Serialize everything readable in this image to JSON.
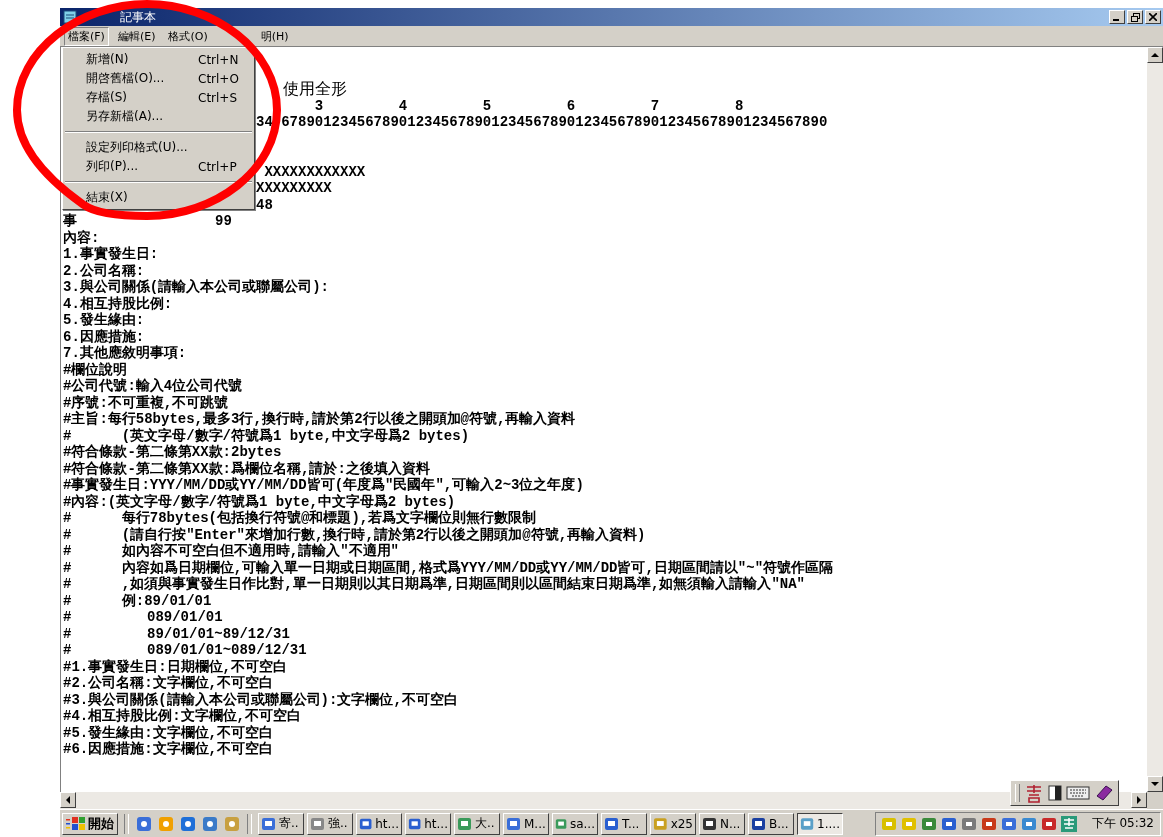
{
  "window": {
    "title": "記事本"
  },
  "menu_bar": [
    {
      "kind": "plain",
      "label": "檔案(F)",
      "selected": true
    },
    {
      "kind": "plain",
      "label": "編輯(E)",
      "selected": false
    },
    {
      "kind": "plain",
      "label": "格式(O)",
      "selected": false
    },
    {
      "kind": "cut",
      "label": "明(H)",
      "selected": false
    }
  ],
  "file_menu": [
    {
      "kind": "item",
      "label": "新增(N)",
      "shortcut": "Ctrl+N"
    },
    {
      "kind": "item",
      "label": "開啓舊檔(O)...",
      "shortcut": "Ctrl+O"
    },
    {
      "kind": "item",
      "label": "存檔(S)",
      "shortcut": "Ctrl+S"
    },
    {
      "kind": "item",
      "label": "另存新檔(A)..."
    },
    {
      "kind": "separator"
    },
    {
      "kind": "item",
      "label": "設定列印格式(U)..."
    },
    {
      "kind": "item",
      "label": "列印(P)...",
      "shortcut": "Ctrl+P"
    },
    {
      "kind": "separator"
    },
    {
      "kind": "item",
      "label": "結束(X)"
    }
  ],
  "editor_lines": [
    {
      "kind": "hidden"
    },
    {
      "kind": "hidden"
    },
    {
      "kind": "beside-menu-large",
      "text": "使用全形"
    },
    {
      "kind": "beside-menu",
      "text": "       3         4         5         6         7         8"
    },
    {
      "kind": "beside-menu-split",
      "parts": [
        "34",
        "67890123456789012345678901234567890123456789012345678901234567890"
      ]
    },
    {
      "kind": "hidden"
    },
    {
      "kind": "hidden"
    },
    {
      "kind": "beside-menu-indent",
      "text": "XXXXXXXXXXXX"
    },
    {
      "kind": "beside-menu",
      "text": "XXXXXXXXX"
    },
    {
      "kind": "beside-menu",
      "text": "48"
    },
    {
      "kind": "split",
      "parts": [
        "事",
        "99"
      ]
    },
    {
      "kind": "plain",
      "text": "內容:"
    },
    {
      "kind": "plain",
      "text": "1.事實發生日:"
    },
    {
      "kind": "plain",
      "text": "2.公司名稱:"
    },
    {
      "kind": "plain",
      "text": "3.與公司關係(請輸入本公司或聯屬公司):"
    },
    {
      "kind": "plain",
      "text": "4.相互持股比例:"
    },
    {
      "kind": "plain",
      "text": "5.發生緣由:"
    },
    {
      "kind": "plain",
      "text": "6.因應措施:"
    },
    {
      "kind": "plain",
      "text": "7.其他應敘明事項:"
    },
    {
      "kind": "plain",
      "text": "#欄位說明"
    },
    {
      "kind": "plain",
      "text": "#公司代號:輸入4位公司代號"
    },
    {
      "kind": "plain",
      "text": "#序號:不可重複,不可跳號"
    },
    {
      "kind": "plain",
      "text": "#主旨:每行58bytes,最多3行,換行時,請於第2行以後之開頭加@符號,再輸入資料"
    },
    {
      "kind": "plain",
      "text": "#      (英文字母/數字/符號爲1 byte,中文字母爲2 bytes)"
    },
    {
      "kind": "plain",
      "text": "#符合條款-第二條第XX款:2bytes"
    },
    {
      "kind": "plain",
      "text": "#符合條款-第二條第XX款:爲欄位名稱,請於:之後填入資料"
    },
    {
      "kind": "plain",
      "text": "#事實發生日:YYY/MM/DD或YY/MM/DD皆可(年度爲\"民國年\",可輸入2~3位之年度)"
    },
    {
      "kind": "plain",
      "text": "#內容:(英文字母/數字/符號爲1 byte,中文字母爲2 bytes)"
    },
    {
      "kind": "plain",
      "text": "#      每行78bytes(包括換行符號@和標題),若爲文字欄位則無行數限制"
    },
    {
      "kind": "plain",
      "text": "#      (請自行按\"Enter\"來增加行數,換行時,請於第2行以後之開頭加@符號,再輸入資料)"
    },
    {
      "kind": "plain",
      "text": "#      如內容不可空白但不適用時,請輸入\"不適用\""
    },
    {
      "kind": "plain",
      "text": "#      內容如爲日期欄位,可輸入單一日期或日期區間,格式爲YYY/MM/DD或YY/MM/DD皆可,日期區間請以\"~\"符號作區隔"
    },
    {
      "kind": "plain",
      "text": "#      ,如須與事實發生日作比對,單一日期則以其日期爲準,日期區間則以區間結束日期爲準,如無須輸入請輸入\"NA\""
    },
    {
      "kind": "plain",
      "text": "#      例:89/01/01"
    },
    {
      "kind": "plain",
      "text": "#         089/01/01"
    },
    {
      "kind": "plain",
      "text": "#         89/01/01~89/12/31"
    },
    {
      "kind": "plain",
      "text": "#         089/01/01~089/12/31"
    },
    {
      "kind": "plain",
      "text": "#1.事實發生日:日期欄位,不可空白"
    },
    {
      "kind": "plain",
      "text": "#2.公司名稱:文字欄位,不可空白"
    },
    {
      "kind": "plain",
      "text": "#3.與公司關係(請輸入本公司或聯屬公司):文字欄位,不可空白"
    },
    {
      "kind": "plain",
      "text": "#4.相互持股比例:文字欄位,不可空白"
    },
    {
      "kind": "plain",
      "text": "#5.發生緣由:文字欄位,不可空白"
    },
    {
      "kind": "plain",
      "text": "#6.因應措施:文字欄位,不可空白"
    }
  ],
  "taskbar": {
    "start_label": "開始",
    "tasks": [
      {
        "label": "寄..",
        "selected": false
      },
      {
        "label": "強..",
        "selected": false
      },
      {
        "label": "ht...",
        "selected": false
      },
      {
        "label": "ht...",
        "selected": false
      },
      {
        "label": "大..",
        "selected": false
      },
      {
        "label": "M...",
        "selected": false
      },
      {
        "label": "sa...",
        "selected": false
      },
      {
        "label": "T...",
        "selected": false
      },
      {
        "label": "x25",
        "selected": false
      },
      {
        "label": "N...",
        "selected": false
      },
      {
        "label": "B...",
        "selected": false
      },
      {
        "label": "1....",
        "selected": true
      }
    ],
    "clock": "下午 05:32"
  }
}
